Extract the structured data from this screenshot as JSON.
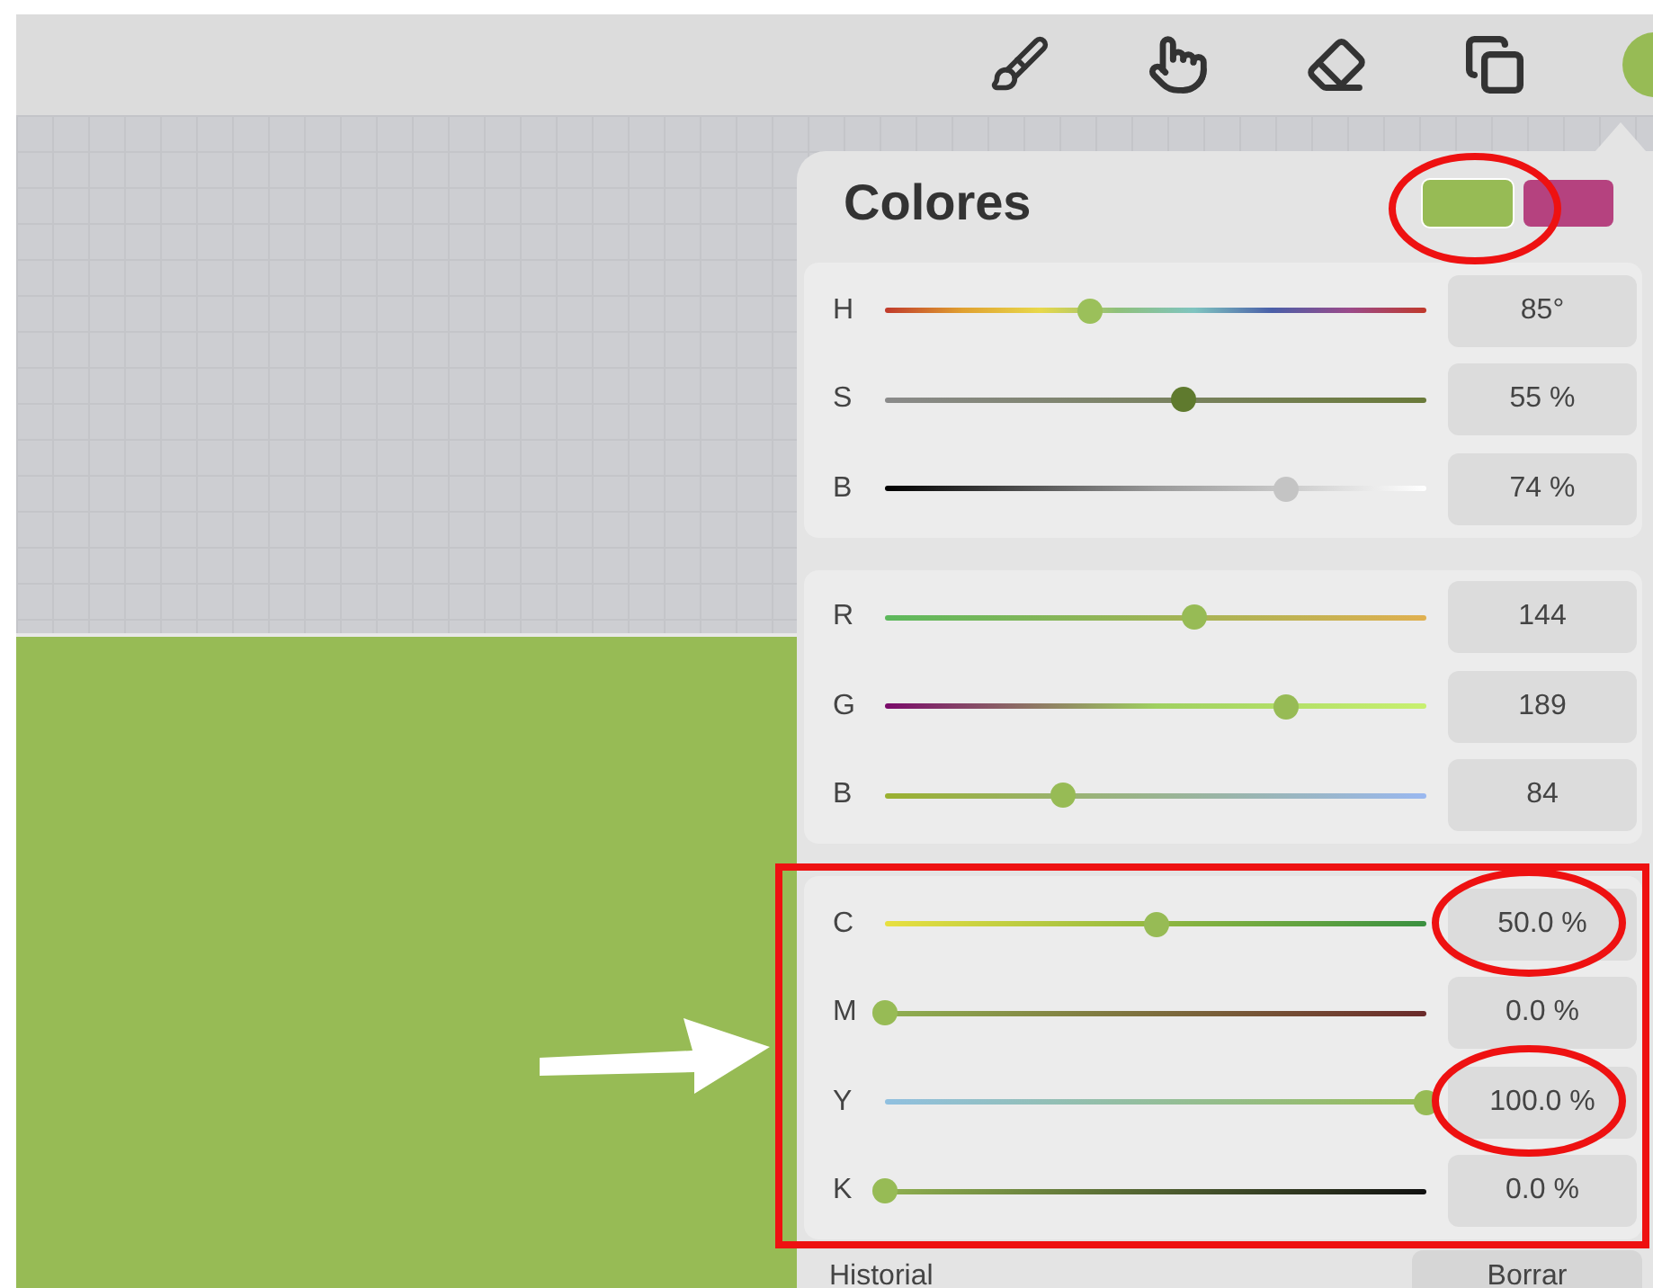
{
  "panel": {
    "title": "Colores",
    "swatches": [
      {
        "color": "#97bb55",
        "selected": true
      },
      {
        "color": "#b5427f",
        "selected": false
      }
    ],
    "groups": [
      {
        "sliders": [
          {
            "label": "H",
            "level": 0.38,
            "value": "85°"
          },
          {
            "label": "S",
            "level": 0.55,
            "value": "55 %"
          },
          {
            "label": "B",
            "level": 0.74,
            "value": "74 %"
          }
        ]
      },
      {
        "sliders": [
          {
            "label": "R",
            "level": 0.57,
            "value": "144"
          },
          {
            "label": "G",
            "level": 0.74,
            "value": "189"
          },
          {
            "label": "B",
            "level": 0.33,
            "value": "84"
          }
        ]
      },
      {
        "sliders": [
          {
            "label": "C",
            "level": 0.5,
            "value": "50.0 %"
          },
          {
            "label": "M",
            "level": 0,
            "value": "0.0 %"
          },
          {
            "label": "Y",
            "level": 1,
            "value": "100.0 %"
          },
          {
            "label": "K",
            "level": 0,
            "value": "0.0 %"
          }
        ]
      }
    ],
    "history": {
      "label": "Historial",
      "button": "Borrar"
    }
  }
}
